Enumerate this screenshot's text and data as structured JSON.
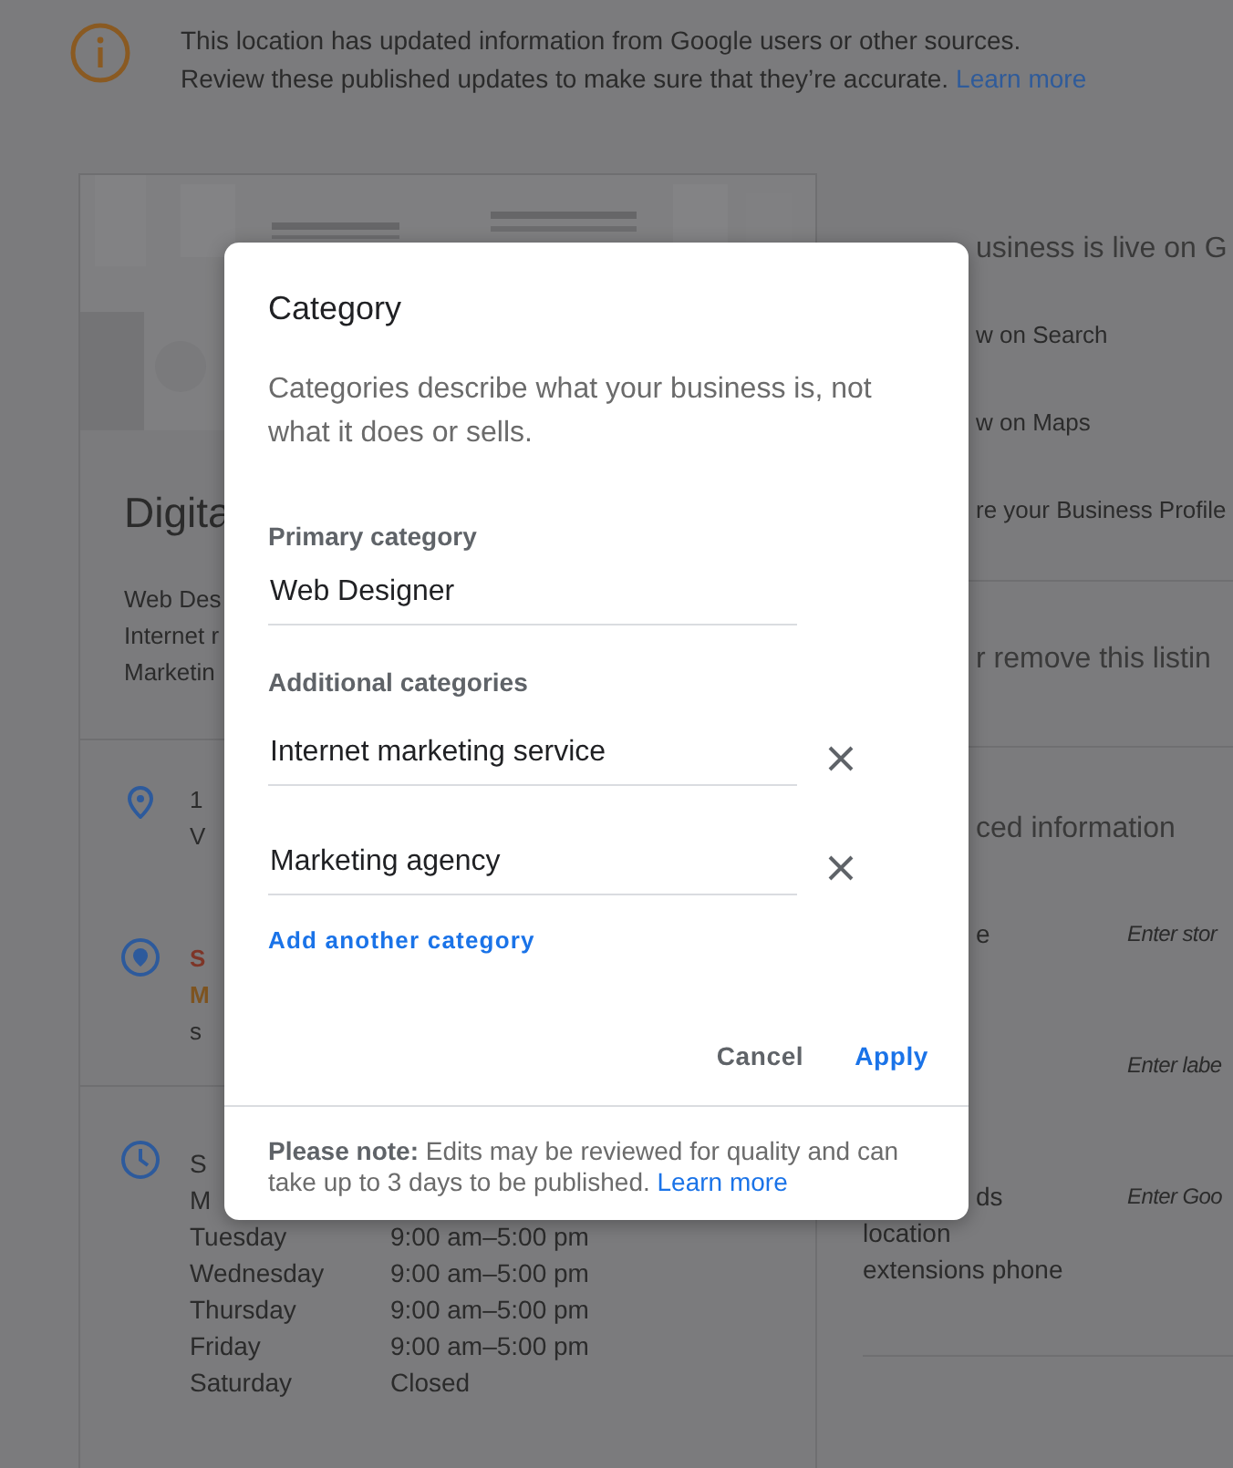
{
  "notice": {
    "lines": [
      "This location has updated information from Google users or other sources.",
      "Review these published updates to make sure that they’re accurate."
    ],
    "link": "Learn more"
  },
  "profile": {
    "name": "Digita",
    "categories": [
      "Web Des",
      "Internet r",
      "Marketin"
    ],
    "rows": [
      {
        "kind": "address",
        "lines": [
          {
            "text": "1"
          },
          {
            "text": "V"
          }
        ]
      },
      {
        "kind": "area",
        "lines": [
          {
            "text": "S",
            "color": "#7e3527"
          },
          {
            "text": "M",
            "color": "#7e5420"
          },
          {
            "text": "s"
          }
        ]
      }
    ],
    "hours": [
      {
        "day": "S"
      },
      {
        "day": "M"
      },
      {
        "day": "Tuesday",
        "time": "9:00 am–5:00 pm"
      },
      {
        "day": "Wednesday",
        "time": "9:00 am–5:00 pm"
      },
      {
        "day": "Thursday",
        "time": "9:00 am–5:00 pm"
      },
      {
        "day": "Friday",
        "time": "9:00 am–5:00 pm"
      },
      {
        "day": "Saturday",
        "time": "Closed"
      }
    ]
  },
  "side": {
    "live_heading": "usiness is live on G",
    "links": [
      "w on Search",
      "w on Maps",
      "re your Business Profile"
    ],
    "remove_heading": "r remove this listin",
    "info_heading": "ced information",
    "fields": [
      {
        "label": [
          "e"
        ],
        "value": "Enter stor"
      },
      {
        "value": "Enter labe"
      },
      {
        "label": [
          "ds",
          "location",
          "extensions phone"
        ],
        "value": "Enter Goo"
      }
    ]
  },
  "dialog": {
    "title": "Category",
    "description": "Categories describe what your business is, not what it does or sells.",
    "primary_label": "Primary category",
    "primary_value": "Web Designer",
    "additional_label": "Additional categories",
    "additional": [
      "Internet marketing service",
      "Marketing agency"
    ],
    "add_link": "Add another category",
    "buttons": [
      {
        "label": "Cancel",
        "kind": "secondary"
      },
      {
        "label": "Apply",
        "kind": "primary"
      }
    ],
    "note": "**Please note:** Edits may be reviewed for quality and can take up to 3 days to be published.",
    "note_link": "Learn more"
  }
}
